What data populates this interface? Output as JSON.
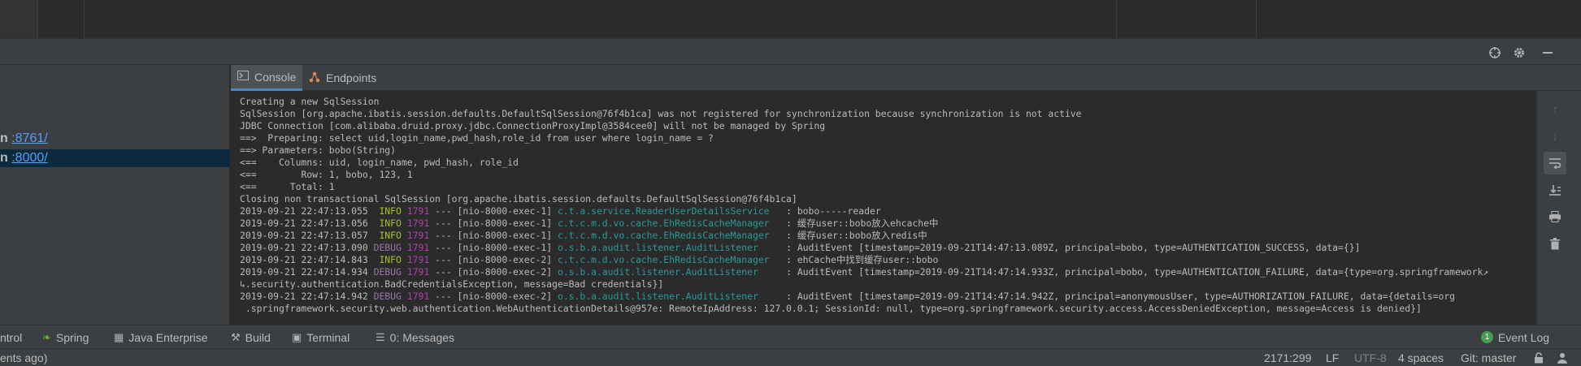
{
  "services": {
    "items": [
      {
        "prefix": "n",
        "link": ":8761/",
        "selected": false
      },
      {
        "prefix": "n",
        "link": ":8000/",
        "selected": true
      }
    ]
  },
  "tabs": [
    {
      "label": "Console",
      "icon": "console-icon",
      "active": true
    },
    {
      "label": "Endpoints",
      "icon": "endpoints-icon",
      "active": false
    }
  ],
  "console": {
    "plain_lines": [
      "Creating a new SqlSession",
      "SqlSession [org.apache.ibatis.session.defaults.DefaultSqlSession@76f4b1ca] was not registered for synchronization because synchronization is not active",
      "JDBC Connection [com.alibaba.druid.proxy.jdbc.ConnectionProxyImpl@3584cee0] will not be managed by Spring",
      "==>  Preparing: select uid,login_name,pwd_hash,role_id from user where login_name = ?",
      "==> Parameters: bobo(String)",
      "<==    Columns: uid, login_name, pwd_hash, role_id",
      "<==        Row: 1, bobo, 123, 1",
      "<==      Total: 1",
      "Closing non transactional SqlSession [org.apache.ibatis.session.defaults.DefaultSqlSession@76f4b1ca]"
    ],
    "log_lines": [
      {
        "ts": "2019-09-21 22:47:13.055",
        "level": " INFO",
        "pid": "1791",
        "sep": " --- ",
        "thread": "[nio-8000-exec-1]",
        "logger": "c.t.a.service.ReaderUserDetailsService  ",
        "msg": " : bobo-----reader"
      },
      {
        "ts": "2019-09-21 22:47:13.056",
        "level": " INFO",
        "pid": "1791",
        "sep": " --- ",
        "thread": "[nio-8000-exec-1]",
        "logger": "c.t.c.m.d.vo.cache.EhRedisCacheManager  ",
        "msg": " : 缓存user::bobo放入ehcache中"
      },
      {
        "ts": "2019-09-21 22:47:13.057",
        "level": " INFO",
        "pid": "1791",
        "sep": " --- ",
        "thread": "[nio-8000-exec-1]",
        "logger": "c.t.c.m.d.vo.cache.EhRedisCacheManager  ",
        "msg": " : 缓存user::bobo放入redis中"
      },
      {
        "ts": "2019-09-21 22:47:13.090",
        "level": "DEBUG",
        "pid": "1791",
        "sep": " --- ",
        "thread": "[nio-8000-exec-1]",
        "logger": "o.s.b.a.audit.listener.AuditListener    ",
        "msg": " : AuditEvent [timestamp=2019-09-21T14:47:13.089Z, principal=bobo, type=AUTHENTICATION_SUCCESS, data={}]"
      },
      {
        "ts": "2019-09-21 22:47:14.843",
        "level": " INFO",
        "pid": "1791",
        "sep": " --- ",
        "thread": "[nio-8000-exec-2]",
        "logger": "c.t.c.m.d.vo.cache.EhRedisCacheManager  ",
        "msg": " : ehCache中找到缓存user::bobo"
      },
      {
        "ts": "2019-09-21 22:47:14.934",
        "level": "DEBUG",
        "pid": "1791",
        "sep": " --- ",
        "thread": "[nio-8000-exec-2]",
        "logger": "o.s.b.a.audit.listener.AuditListener    ",
        "msg": " : AuditEvent [timestamp=2019-09-21T14:47:14.933Z, principal=bobo, type=AUTHENTICATION_FAILURE, data={type=org.springframework↗"
      }
    ],
    "wrap1": "↳.security.authentication.BadCredentialsException, message=Bad credentials}]",
    "log_last": {
      "ts": "2019-09-21 22:47:14.942",
      "level": "DEBUG",
      "pid": "1791",
      "sep": " --- ",
      "thread": "[nio-8000-exec-2]",
      "logger": "o.s.b.a.audit.listener.AuditListener    ",
      "msg": " : AuditEvent [timestamp=2019-09-21T14:47:14.942Z, principal=anonymousUser, type=AUTHORIZATION_FAILURE, data={details=org"
    },
    "wrap2": " .springframework.security.web.authentication.WebAuthenticationDetails@957e: RemoteIpAddress: 127.0.0.1; SessionId: null, type=org.springframework.security.access.AccessDeniedException, message=Access is denied}]"
  },
  "tool_stripe": {
    "items": [
      {
        "label": "ntrol",
        "icon": ""
      },
      {
        "label": "Spring",
        "icon": "spring-icon"
      },
      {
        "label": "Java Enterprise",
        "icon": "java-enterprise-icon"
      },
      {
        "label": "Build",
        "icon": "build-icon"
      },
      {
        "label": "Terminal",
        "icon": "terminal-icon"
      },
      {
        "label": "0: Messages",
        "icon": "messages-icon"
      }
    ],
    "event_log": "Event Log",
    "event_log_count": "1"
  },
  "status_bar": {
    "left_text": "ents ago)",
    "position": "2171:299",
    "line_sep": "LF",
    "encoding": "UTF-8",
    "indent": "4 spaces",
    "vcs": "Git: master"
  },
  "colors": {
    "info": "#a8c023",
    "debug": "#9876aa",
    "pid": "#b03fb1",
    "logger": "#299999",
    "link": "#589df6",
    "selection": "#0d293e"
  }
}
